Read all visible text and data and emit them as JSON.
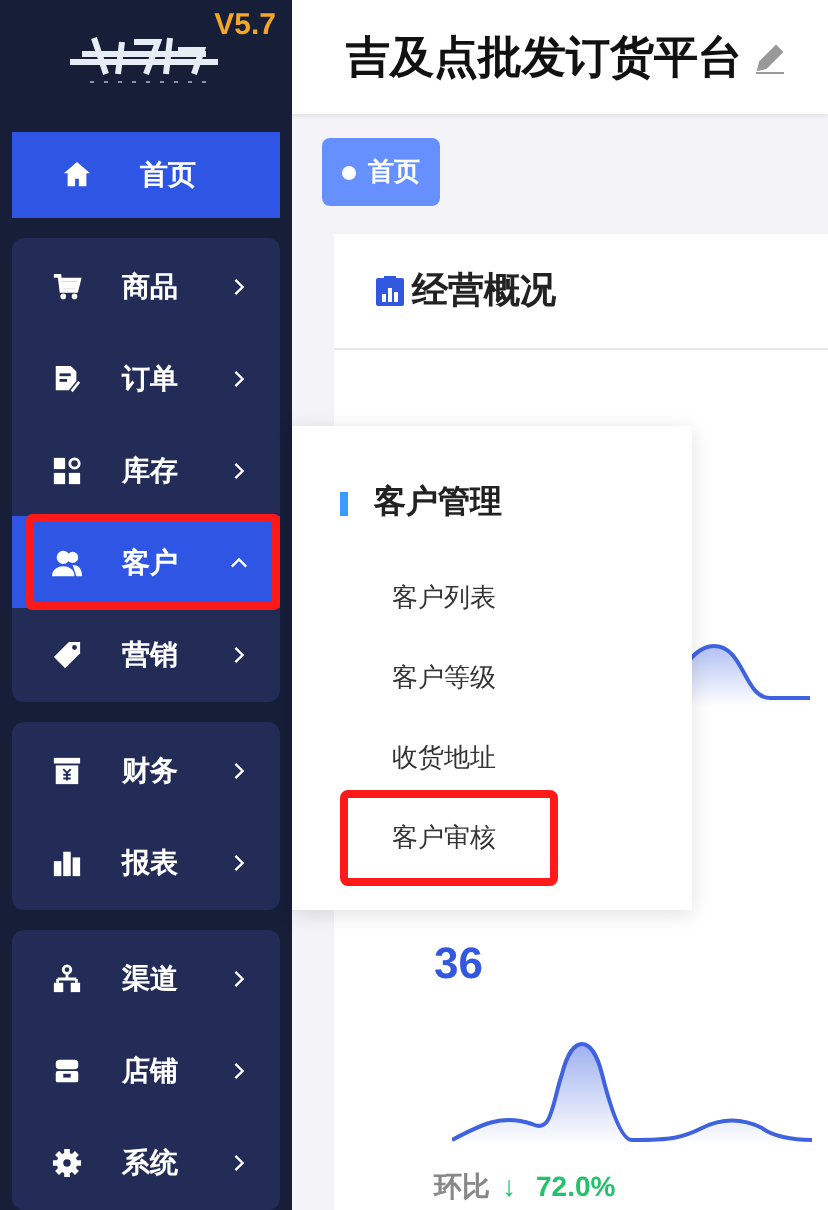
{
  "logo": {
    "version": "V5.7"
  },
  "header": {
    "title": "吉及点批发订货平台"
  },
  "tabs": [
    {
      "label": "首页",
      "selected": true
    }
  ],
  "sidebar": {
    "home": {
      "label": "首页",
      "selected": true
    },
    "groups": [
      {
        "items": [
          {
            "kind": "cart",
            "label": "商品",
            "expanded": false,
            "selected": false,
            "highlighted": false
          },
          {
            "kind": "order",
            "label": "订单",
            "expanded": false,
            "selected": false,
            "highlighted": false
          },
          {
            "kind": "stock",
            "label": "库存",
            "expanded": false,
            "selected": false,
            "highlighted": false
          },
          {
            "kind": "users",
            "label": "客户",
            "expanded": true,
            "selected": true,
            "highlighted": true
          },
          {
            "kind": "tag",
            "label": "营销",
            "expanded": false,
            "selected": false,
            "highlighted": false
          }
        ]
      },
      {
        "items": [
          {
            "kind": "finance",
            "label": "财务",
            "expanded": false,
            "selected": false,
            "highlighted": false
          },
          {
            "kind": "chart",
            "label": "报表",
            "expanded": false,
            "selected": false,
            "highlighted": false
          }
        ]
      },
      {
        "items": [
          {
            "kind": "channel",
            "label": "渠道",
            "expanded": false,
            "selected": false,
            "highlighted": false
          },
          {
            "kind": "store",
            "label": "店铺",
            "expanded": false,
            "selected": false,
            "highlighted": false
          },
          {
            "kind": "gear",
            "label": "系统",
            "expanded": false,
            "selected": false,
            "highlighted": false
          }
        ]
      }
    ]
  },
  "submenu": {
    "title": "客户管理",
    "items": [
      {
        "label": "客户列表",
        "highlighted": false
      },
      {
        "label": "客户等级",
        "highlighted": false
      },
      {
        "label": "收货地址",
        "highlighted": false
      },
      {
        "label": "客户审核",
        "highlighted": true
      }
    ]
  },
  "card": {
    "title": "经营概况",
    "value": "36",
    "compare_label": "环比",
    "compare_arrow": "↓",
    "compare_value": "72.0%"
  }
}
